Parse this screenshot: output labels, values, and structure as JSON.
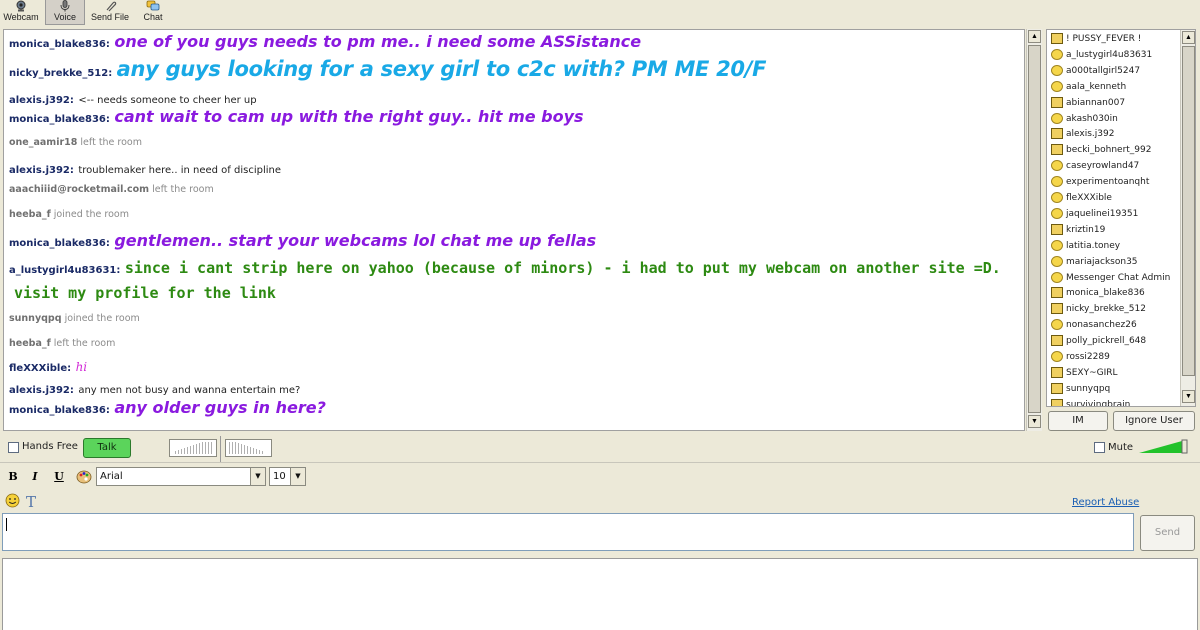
{
  "toolbar": {
    "webcam_label": "Webcam",
    "voice_label": "Voice",
    "sendfile_label": "Send File",
    "chat_label": "Chat"
  },
  "chat": {
    "m1_user": "monica_blake836:",
    "m1_text": "one of you guys needs to pm me.. i need some ASSistance",
    "m2_user": "nicky_brekke_512:",
    "m2_text": "any guys looking for a sexy girl to c2c with? PM ME 20/F",
    "m3_user": "alexis.j392:",
    "m3_text": "<-- needs someone to cheer her up",
    "m4_user": "monica_blake836:",
    "m4_text": "cant wait to cam up with the right guy.. hit me boys",
    "e1_user": "one_aamir18",
    "e1_text": "left the room",
    "m5_user": "alexis.j392:",
    "m5_text": "troublemaker here.. in need of discipline",
    "e2_user": "aaachiiid@rocketmail.com",
    "e2_text": "left the room",
    "e3_user": "heeba_f",
    "e3_text": "joined the room",
    "m6_user": "monica_blake836:",
    "m6_text": "gentlemen.. start your webcams lol chat me up fellas",
    "m7_user": "a_lustygirl4u83631:",
    "m7_text": "since i cant strip here on yahoo (because of minors) - i had to put my webcam on another site =D.",
    "m7_text2": "visit my profile for the link",
    "e4_user": "sunnyqpq",
    "e4_text": "joined the room",
    "e5_user": "heeba_f",
    "e5_text": "left the room",
    "m8_user": "fleXXXible:",
    "m8_text": "hi",
    "m9_user": "alexis.j392:",
    "m9_text": "any men not busy and wanna entertain me?",
    "m10_user": "monica_blake836:",
    "m10_text": "any older guys in here?"
  },
  "users": [
    {
      "name": "! PUSSY_FEVER !",
      "icon": "webcam-icon"
    },
    {
      "name": "a_lustygirl4u83631",
      "icon": "smiley-icon"
    },
    {
      "name": "a000tallgirl5247",
      "icon": "smiley-icon"
    },
    {
      "name": "aala_kenneth",
      "icon": "smiley-icon"
    },
    {
      "name": "abiannan007",
      "icon": "webcam-icon"
    },
    {
      "name": "akash030in",
      "icon": "smiley-icon"
    },
    {
      "name": "alexis.j392",
      "icon": "webcam-icon"
    },
    {
      "name": "becki_bohnert_992",
      "icon": "webcam-icon"
    },
    {
      "name": "caseyrowland47",
      "icon": "smiley-icon"
    },
    {
      "name": "experimentoanqht",
      "icon": "smiley-icon"
    },
    {
      "name": "fleXXXible",
      "icon": "smiley-icon"
    },
    {
      "name": "jaquelinei19351",
      "icon": "smiley-icon"
    },
    {
      "name": "kriztin19",
      "icon": "webcam-icon"
    },
    {
      "name": "latitia.toney",
      "icon": "smiley-icon"
    },
    {
      "name": "mariajackson35",
      "icon": "smiley-icon"
    },
    {
      "name": "Messenger Chat Admin",
      "icon": "smiley-icon"
    },
    {
      "name": "monica_blake836",
      "icon": "webcam-icon"
    },
    {
      "name": "nicky_brekke_512",
      "icon": "webcam-icon"
    },
    {
      "name": "nonasanchez26",
      "icon": "smiley-icon"
    },
    {
      "name": "polly_pickrell_648",
      "icon": "webcam-icon"
    },
    {
      "name": "rossi2289",
      "icon": "smiley-icon"
    },
    {
      "name": "SEXY~GIRL",
      "icon": "webcam-icon"
    },
    {
      "name": "sunnyqpq",
      "icon": "webcam-icon"
    },
    {
      "name": "survivingbrain",
      "icon": "webcam-icon"
    }
  ],
  "buttons": {
    "im": "IM",
    "ignore": "Ignore User",
    "talk": "Talk",
    "send": "Send"
  },
  "voice": {
    "handsfree_label": "Hands Free",
    "mute_label": "Mute"
  },
  "format": {
    "bold": "B",
    "italic": "I",
    "underline": "U",
    "font_value": "Arial",
    "size_value": "10"
  },
  "links": {
    "report_abuse": "Report Abuse"
  },
  "colors": {
    "purple": "#8a1adf",
    "cyan": "#19a9e6",
    "green": "#2d8a12",
    "talk_green": "#5bd45b"
  }
}
